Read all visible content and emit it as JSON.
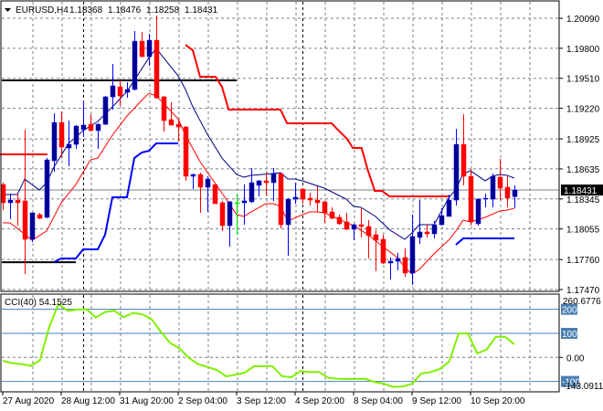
{
  "header": {
    "symbol": "EURUSD,H4",
    "open": "1.18368",
    "high": "1.18476",
    "low": "1.18258",
    "close": "1.18431"
  },
  "colors": {
    "bull_body": "#00008f",
    "bull_wick": "#0000ff",
    "bear": "#ff0000",
    "doji": "#00e000",
    "ma_fast": "#000080",
    "ma_slow": "#ff0000",
    "stop_upper": "#ff0000",
    "stop_lower": "#0000ff",
    "level_line": "#000000",
    "cci_line": "#80f000",
    "cci_levels": "#4a7fb0",
    "grid": "#78808a"
  },
  "price_axis": {
    "ticks": [
      "1.20090",
      "1.19800",
      "1.19510",
      "1.19220",
      "1.18925",
      "1.18635",
      "1.18345",
      "1.18055",
      "1.17760",
      "1.17470"
    ],
    "max": 1.2009,
    "min": 1.1747,
    "current_price_label": "1.18431",
    "current_price": 1.18431
  },
  "time_axis": {
    "labels": [
      "27 Aug 2020",
      "28 Aug 12:00",
      "31 Aug 20:00",
      "2 Sep 04:00",
      "3 Sep 12:00",
      "4 Sep 20:00",
      "8 Sep 04:00",
      "9 Sep 12:00",
      "10 Sep 20:00"
    ],
    "bars_per_label": 8,
    "period_separator_bars": [
      11,
      41
    ]
  },
  "candles": [
    [
      1.18484,
      1.18502,
      1.18237,
      1.18308
    ],
    [
      1.18308,
      1.18396,
      1.18149,
      1.18334
    ],
    [
      1.18334,
      1.18396,
      1.18087,
      1.18308
    ],
    [
      1.18326,
      1.19014,
      1.1762,
      1.17955
    ],
    [
      1.17955,
      1.18211,
      1.17929,
      1.18211
    ],
    [
      1.18193,
      1.18211,
      1.18149,
      1.18158
    ],
    [
      1.18167,
      1.1874,
      1.18158,
      1.18722
    ],
    [
      1.18714,
      1.19172,
      1.18608,
      1.19084
    ],
    [
      1.19084,
      1.1919,
      1.1874,
      1.18846
    ],
    [
      1.18837,
      1.19102,
      1.18661,
      1.18872
    ],
    [
      1.18872,
      1.19058,
      1.18828,
      1.19049
    ],
    [
      1.19014,
      1.19296,
      1.18943,
      1.19058
    ],
    [
      1.19066,
      1.19163,
      1.18996,
      1.19005
    ],
    [
      1.19005,
      1.19075,
      1.18828,
      1.19066
    ],
    [
      1.19066,
      1.1934,
      1.19058,
      1.19331
    ],
    [
      1.19331,
      1.19649,
      1.19208,
      1.19437
    ],
    [
      1.19428,
      1.1949,
      1.19243,
      1.1934
    ],
    [
      1.19375,
      1.19472,
      1.19322,
      1.19402
    ],
    [
      1.19402,
      1.19966,
      1.19393,
      1.19869
    ],
    [
      1.19869,
      1.19957,
      1.19719,
      1.19719
    ],
    [
      1.19719,
      1.1994,
      1.19631,
      1.19878
    ],
    [
      1.19878,
      1.20116,
      1.19313,
      1.19322
    ],
    [
      1.19331,
      1.1934,
      1.18996,
      1.19102
    ],
    [
      1.19111,
      1.19278,
      1.19058,
      1.19058
    ],
    [
      1.19066,
      1.19102,
      1.18899,
      1.1904
    ],
    [
      1.1904,
      1.19049,
      1.1852,
      1.18564
    ],
    [
      1.18564,
      1.1859,
      1.1844,
      1.18581
    ],
    [
      1.18581,
      1.18599,
      1.18211,
      1.18458
    ],
    [
      1.18458,
      1.18564,
      1.1822,
      1.18537
    ],
    [
      1.18484,
      1.18484,
      1.18299,
      1.18299
    ],
    [
      1.18308,
      1.18326,
      1.18035,
      1.18087
    ],
    [
      1.18087,
      1.18326,
      1.17885,
      1.18317
    ],
    [
      1.18308,
      1.18396,
      1.17999,
      1.18308
    ],
    [
      1.18308,
      1.18484,
      1.18096,
      1.18326
    ],
    [
      1.18317,
      1.18643,
      1.18308,
      1.18502
    ],
    [
      1.18476,
      1.18528,
      1.1837,
      1.1852
    ],
    [
      1.1852,
      1.18608,
      1.18379,
      1.18502
    ],
    [
      1.18502,
      1.18643,
      1.18326,
      1.1859
    ],
    [
      1.1859,
      1.1859,
      1.18061,
      1.18096
    ],
    [
      1.18096,
      1.18352,
      1.17796,
      1.18343
    ],
    [
      1.18343,
      1.18502,
      1.18299,
      1.18361
    ],
    [
      1.1844,
      1.18449,
      1.18299,
      1.18343
    ],
    [
      1.18352,
      1.18405,
      1.18281,
      1.18334
    ],
    [
      1.18334,
      1.18467,
      1.1822,
      1.18308
    ],
    [
      1.18317,
      1.18317,
      1.18114,
      1.18211
    ],
    [
      1.1822,
      1.18264,
      1.18149,
      1.18158
    ],
    [
      1.18167,
      1.18193,
      1.18096,
      1.18105
    ],
    [
      1.18123,
      1.18211,
      1.18043,
      1.18052
    ],
    [
      1.18052,
      1.18105,
      1.17946,
      1.18096
    ],
    [
      1.18096,
      1.18264,
      1.17973,
      1.18079
    ],
    [
      1.18079,
      1.1814,
      1.1777,
      1.1799
    ],
    [
      1.17999,
      1.18043,
      1.17646,
      1.17946
    ],
    [
      1.17955,
      1.17999,
      1.17717,
      1.17726
    ],
    [
      1.17726,
      1.17779,
      1.17567,
      1.17743
    ],
    [
      1.17743,
      1.17823,
      1.17655,
      1.1777
    ],
    [
      1.17779,
      1.17867,
      1.17594,
      1.17629
    ],
    [
      1.17629,
      1.18193,
      1.17514,
      1.17982
    ],
    [
      1.17973,
      1.18334,
      1.17911,
      1.18026
    ],
    [
      1.18026,
      1.18096,
      1.17973,
      1.18008
    ],
    [
      1.18008,
      1.18132,
      1.17964,
      1.18096
    ],
    [
      1.18096,
      1.18255,
      1.18087,
      1.18184
    ],
    [
      1.18176,
      1.18387,
      1.18176,
      1.18334
    ],
    [
      1.18334,
      1.19022,
      1.18281,
      1.18872
    ],
    [
      1.18872,
      1.19163,
      1.18476,
      1.18564
    ],
    [
      1.18564,
      1.18634,
      1.18087,
      1.18123
    ],
    [
      1.18105,
      1.18352,
      1.18087,
      1.18343
    ],
    [
      1.18343,
      1.18396,
      1.18264,
      1.18352
    ],
    [
      1.18343,
      1.1859,
      1.18264,
      1.18564
    ],
    [
      1.18555,
      1.18731,
      1.18334,
      1.18449
    ],
    [
      1.18458,
      1.18564,
      1.18264,
      1.18352
    ],
    [
      1.18368,
      1.18476,
      1.18258,
      1.18431
    ]
  ],
  "ma_fast": [
    [
      0,
      1.18387
    ],
    [
      2,
      1.18387
    ],
    [
      3,
      1.18537
    ],
    [
      5,
      1.18431
    ],
    [
      6,
      1.18502
    ],
    [
      7,
      1.18652
    ],
    [
      9,
      1.18881
    ],
    [
      11,
      1.19005
    ],
    [
      13,
      1.19093
    ],
    [
      15,
      1.19234
    ],
    [
      17,
      1.19384
    ],
    [
      18,
      1.1949
    ],
    [
      20,
      1.19709
    ],
    [
      21,
      1.19799
    ],
    [
      22,
      1.19709
    ],
    [
      24,
      1.19534
    ],
    [
      25,
      1.19402
    ],
    [
      26,
      1.19234
    ],
    [
      28,
      1.18969
    ],
    [
      30,
      1.1874
    ],
    [
      32,
      1.18581
    ],
    [
      33,
      1.18555
    ],
    [
      34,
      1.18573
    ],
    [
      37,
      1.1859
    ],
    [
      38,
      1.18599
    ],
    [
      39,
      1.18537
    ],
    [
      40,
      1.18537
    ],
    [
      41,
      1.1852
    ],
    [
      44,
      1.18449
    ],
    [
      47,
      1.18343
    ],
    [
      48,
      1.18273
    ],
    [
      49,
      1.18264
    ],
    [
      51,
      1.18176
    ],
    [
      53,
      1.18043
    ],
    [
      55,
      1.17955
    ],
    [
      56,
      1.18017
    ],
    [
      57,
      1.18096
    ],
    [
      59,
      1.18096
    ],
    [
      61,
      1.18352
    ],
    [
      62,
      1.1844
    ],
    [
      63,
      1.1859
    ],
    [
      64,
      1.18617
    ],
    [
      66,
      1.1852
    ],
    [
      67,
      1.18564
    ],
    [
      68,
      1.18581
    ],
    [
      69,
      1.18573
    ],
    [
      70,
      1.18546
    ]
  ],
  "ma_slow": [
    [
      0,
      1.18114
    ],
    [
      1,
      1.18114
    ],
    [
      2,
      1.18061
    ],
    [
      4,
      1.17946
    ],
    [
      6,
      1.18035
    ],
    [
      8,
      1.18308
    ],
    [
      10,
      1.18484
    ],
    [
      12,
      1.18722
    ],
    [
      13,
      1.1874
    ],
    [
      15,
      1.18961
    ],
    [
      17,
      1.19146
    ],
    [
      19,
      1.19296
    ],
    [
      20,
      1.19366
    ],
    [
      21,
      1.1934
    ],
    [
      22,
      1.19269
    ],
    [
      24,
      1.19119
    ],
    [
      25,
      1.18961
    ],
    [
      27,
      1.18705
    ],
    [
      29,
      1.18502
    ],
    [
      31,
      1.18299
    ],
    [
      32,
      1.18193
    ],
    [
      33,
      1.18176
    ],
    [
      34,
      1.1822
    ],
    [
      36,
      1.18299
    ],
    [
      37,
      1.18299
    ],
    [
      38,
      1.18273
    ],
    [
      39,
      1.18132
    ],
    [
      41,
      1.18193
    ],
    [
      42,
      1.1822
    ],
    [
      43,
      1.1822
    ],
    [
      44,
      1.18211
    ],
    [
      46,
      1.18149
    ],
    [
      48,
      1.18087
    ],
    [
      50,
      1.17999
    ],
    [
      52,
      1.17885
    ],
    [
      54,
      1.17779
    ],
    [
      55,
      1.17682
    ],
    [
      56,
      1.1762
    ],
    [
      57,
      1.17664
    ],
    [
      59,
      1.17814
    ],
    [
      61,
      1.17946
    ],
    [
      62,
      1.18035
    ],
    [
      63,
      1.1814
    ],
    [
      64,
      1.18123
    ],
    [
      66,
      1.18167
    ],
    [
      68,
      1.18229
    ],
    [
      69,
      1.18237
    ],
    [
      70,
      1.18255
    ]
  ],
  "stop_upper": [
    [
      [
        -0.4,
        1.18776
      ],
      [
        6.1,
        1.18776
      ]
    ],
    [
      [
        25,
        1.19834
      ],
      [
        26,
        1.19781
      ],
      [
        27,
        1.19525
      ],
      [
        29.1,
        1.19525
      ],
      [
        30,
        1.19428
      ],
      [
        30.9,
        1.19208
      ],
      [
        38,
        1.19208
      ],
      [
        38.9,
        1.19075
      ],
      [
        45,
        1.19075
      ],
      [
        45.6,
        1.19031
      ],
      [
        47.1,
        1.18925
      ],
      [
        47.9,
        1.18837
      ],
      [
        49.1,
        1.18837
      ],
      [
        49.9,
        1.18634
      ],
      [
        50.9,
        1.18423
      ],
      [
        51.9,
        1.18423
      ],
      [
        52.9,
        1.1837
      ],
      [
        61,
        1.1837
      ]
    ]
  ],
  "stop_lower": [
    [
      [
        7,
        1.17735
      ],
      [
        8,
        1.1777
      ],
      [
        10,
        1.1777
      ],
      [
        11,
        1.17858
      ],
      [
        13,
        1.17858
      ],
      [
        14,
        1.17999
      ],
      [
        15,
        1.18361
      ],
      [
        17,
        1.18361
      ],
      [
        18,
        1.1874
      ],
      [
        19,
        1.18793
      ],
      [
        20,
        1.1881
      ],
      [
        21,
        1.18881
      ],
      [
        24,
        1.18881
      ]
    ],
    [
      [
        62,
        1.17902
      ],
      [
        63,
        1.17964
      ],
      [
        70,
        1.17964
      ]
    ]
  ],
  "levels": [
    {
      "price": 1.1949,
      "to_bar": 32
    },
    {
      "price": 1.17734,
      "to_bar": 10
    }
  ],
  "cci": {
    "label": "CCI(40) 54.1525",
    "max_label": "260.6776",
    "min_label": "-143.0911",
    "max": 260.6776,
    "min": -143.0911,
    "level_labels": [
      "200",
      "100",
      "-100"
    ],
    "level_values": [
      200,
      100,
      -100
    ],
    "zero_label": "0.00",
    "values": [
      -14,
      -24,
      -28,
      -35,
      -12,
      127,
      222,
      193,
      199,
      200,
      166,
      189,
      194,
      167,
      185,
      179,
      159,
      106,
      60,
      37,
      -2,
      -28,
      -40,
      -52,
      -79,
      -72,
      -64,
      -37,
      -37,
      -37,
      -78,
      -83,
      -57,
      -61,
      -61,
      -85,
      -89,
      -90,
      -90,
      -89,
      -103,
      -110,
      -123,
      -121,
      -110,
      -67,
      -61,
      -48,
      -17,
      99,
      100,
      17,
      32,
      85,
      86,
      54.15
    ]
  }
}
